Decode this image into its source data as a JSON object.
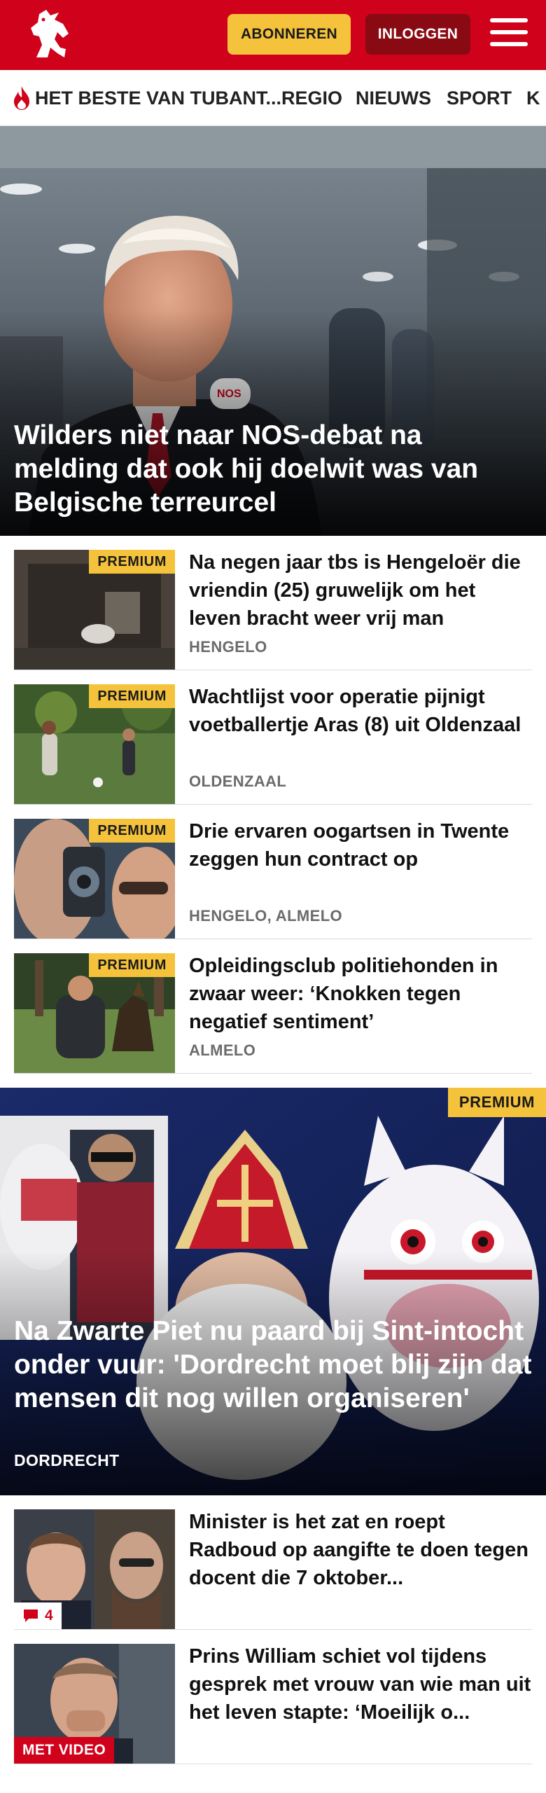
{
  "header": {
    "subscribe_label": "ABONNEREN",
    "login_label": "INLOGGEN",
    "menu_icon": "hamburger-menu-icon",
    "logo_icon": "tubantia-horse-logo-icon",
    "brand_color": "#d0021b",
    "accent_color": "#f5c33b"
  },
  "nav": {
    "items": [
      {
        "label": "HET BESTE VAN TUBANT...",
        "icon": "flame-icon"
      },
      {
        "label": "REGIO"
      },
      {
        "label": "NIEUWS"
      },
      {
        "label": "SPORT"
      },
      {
        "label": "K"
      }
    ]
  },
  "hero": {
    "title": "Wilders niet naar NOS-debat na melding dat ook hij doelwit was van Belgische terreurcel"
  },
  "articles": [
    {
      "badge": "PREMIUM",
      "title": "Na negen jaar tbs is Hengeloër die vriendin (25) gruwelijk om het leven bracht weer vrij man",
      "location": "HENGELO"
    },
    {
      "badge": "PREMIUM",
      "title": "Wachtlijst voor operatie pijnigt voetballertje Aras (8) uit Oldenzaal",
      "location": "OLDENZAAL"
    },
    {
      "badge": "PREMIUM",
      "title": "Drie ervaren oogartsen in Twente zeggen hun contract op",
      "location": "HENGELO, ALMELO"
    },
    {
      "badge": "PREMIUM",
      "title": "Opleidingsclub politiehonden in zwaar weer: ‘Knokken tegen negatief sentiment’",
      "location": "ALMELO"
    }
  ],
  "feature": {
    "badge": "PREMIUM",
    "title": "Na Zwarte Piet nu paard bij Sint-intocht onder vuur: 'Dordrecht moet blij zijn dat mensen dit nog willen organiseren'",
    "location": "DORDRECHT"
  },
  "more_articles": [
    {
      "title": "Minister is het zat en roept Radboud op aangifte te doen tegen docent die 7 oktober...",
      "comment_count": "4",
      "comment_icon": "comment-icon"
    },
    {
      "title": "Prins William schiet vol tijdens gesprek met vrouw van wie man uit het leven stapte: ‘Moeilijk o...",
      "video_badge": "MET VIDEO"
    }
  ]
}
